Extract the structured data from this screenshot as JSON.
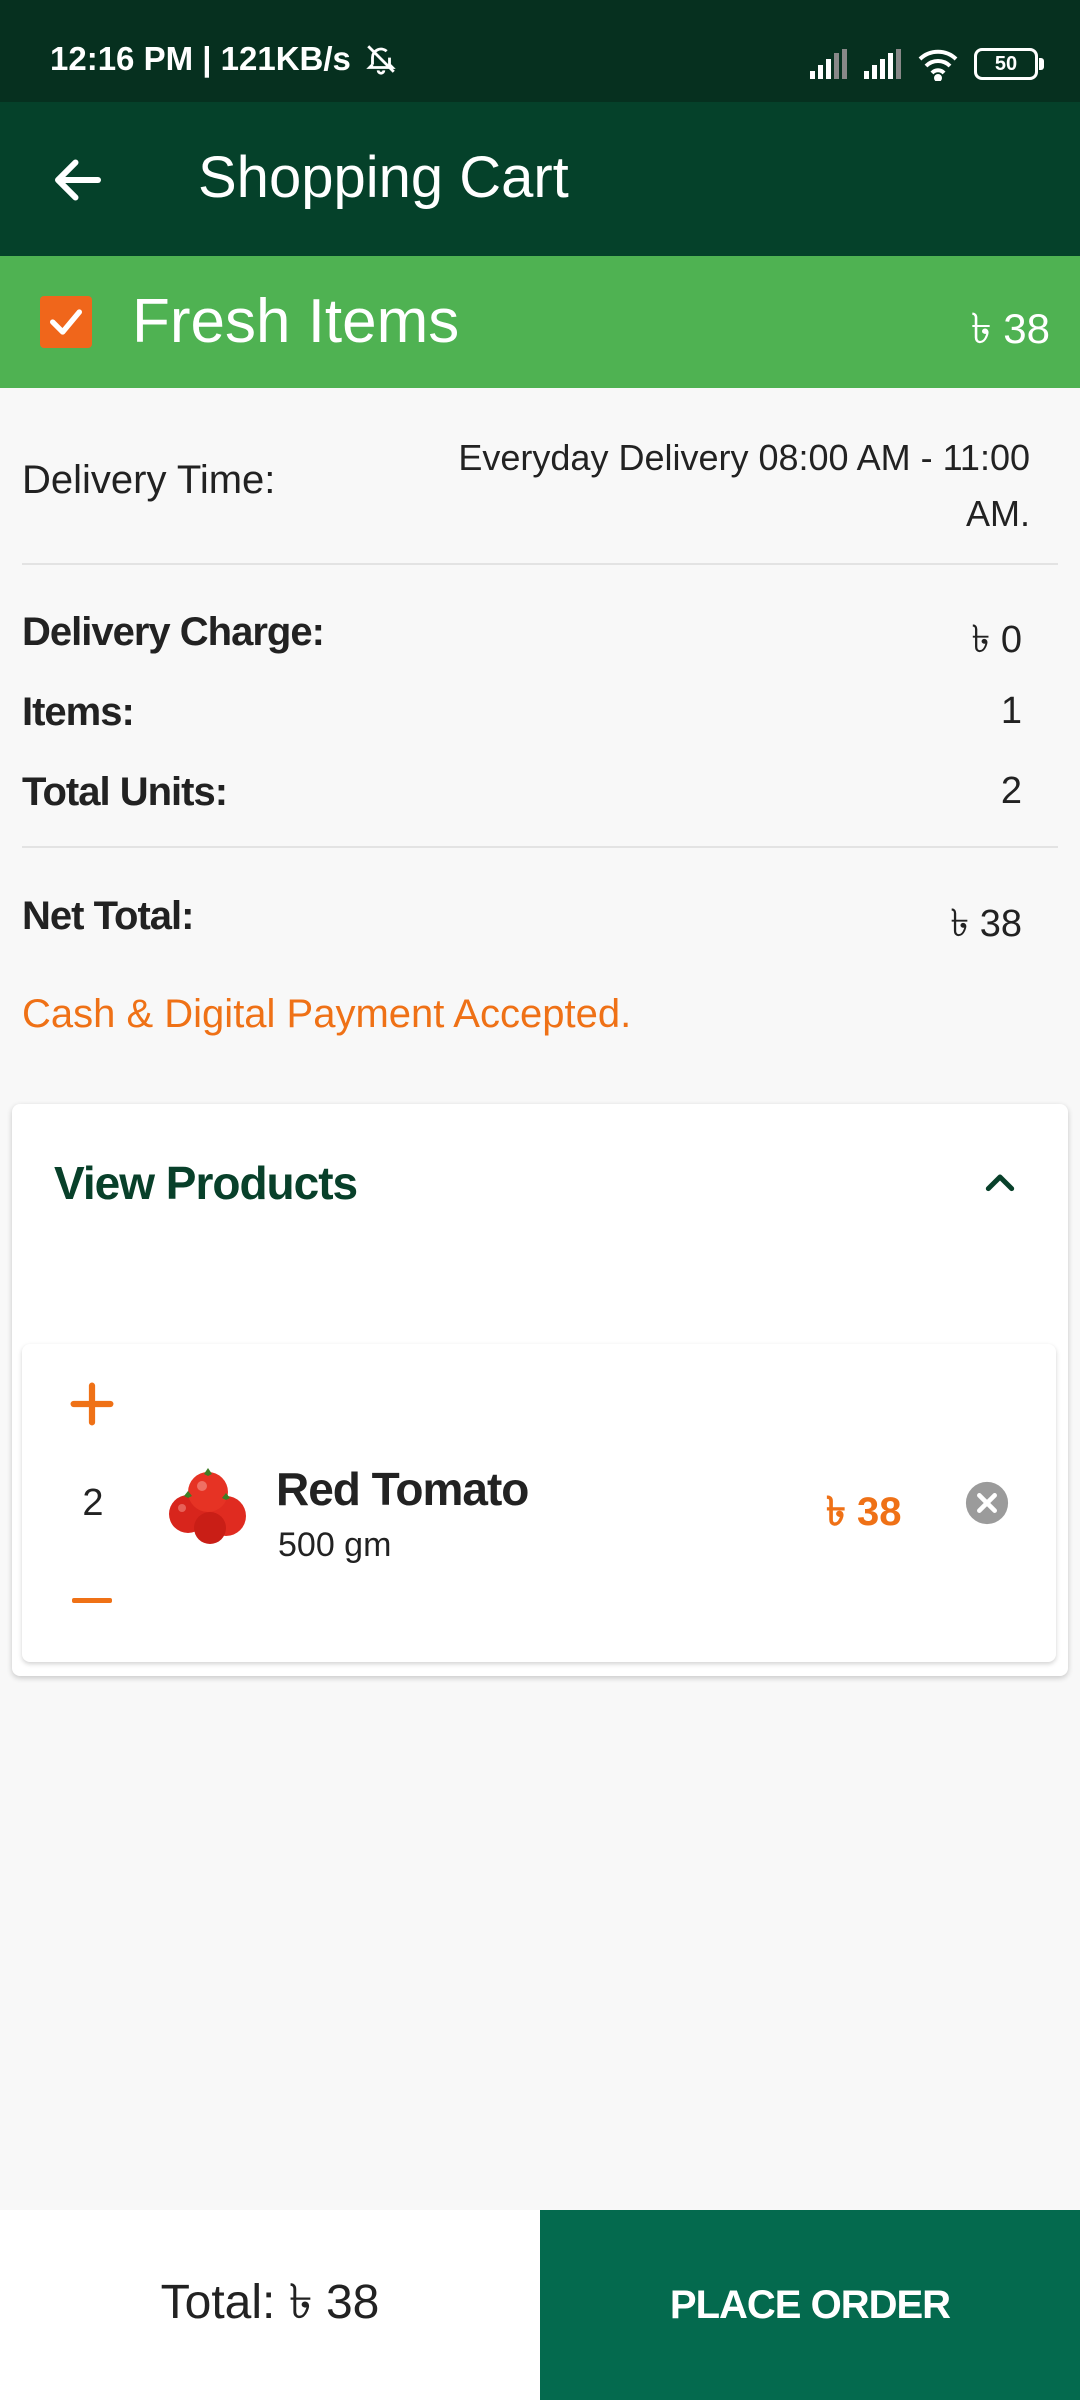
{
  "status_bar": {
    "time_speed": "12:16 PM | 121KB/s",
    "battery": "50",
    "icons": [
      "mute-bell-icon",
      "signal-icon",
      "signal-icon",
      "wifi-icon",
      "battery-icon"
    ]
  },
  "app_bar": {
    "title": "Shopping Cart",
    "back_icon": "arrow-left-icon"
  },
  "section": {
    "label": "Fresh Items",
    "amount": "৳ 38",
    "checked": true
  },
  "summary": {
    "delivery_time_label": "Delivery Time:",
    "delivery_time_value": "Everyday Delivery 08:00 AM - 11:00 AM.",
    "delivery_charge_label": "Delivery Charge:",
    "delivery_charge_value": "৳ 0",
    "items_label": "Items:",
    "items_value": "1",
    "units_label": "Total Units:",
    "units_value": "2",
    "net_total_label": "Net Total:",
    "net_total_value": "৳ 38",
    "payment_note": "Cash & Digital Payment Accepted."
  },
  "products": {
    "header": "View Products",
    "list": [
      {
        "quantity": "2",
        "name": "Red Tomato",
        "weight": "500 gm",
        "price": "৳ 38"
      }
    ]
  },
  "footer": {
    "total": "Total: ৳ 38",
    "place_order": "PLACE ORDER"
  },
  "colors": {
    "status_bar": "#06301f",
    "app_bar": "#05412a",
    "band": "#4fb252",
    "accent_orange": "#ef7116",
    "order_button": "#046a4e"
  }
}
